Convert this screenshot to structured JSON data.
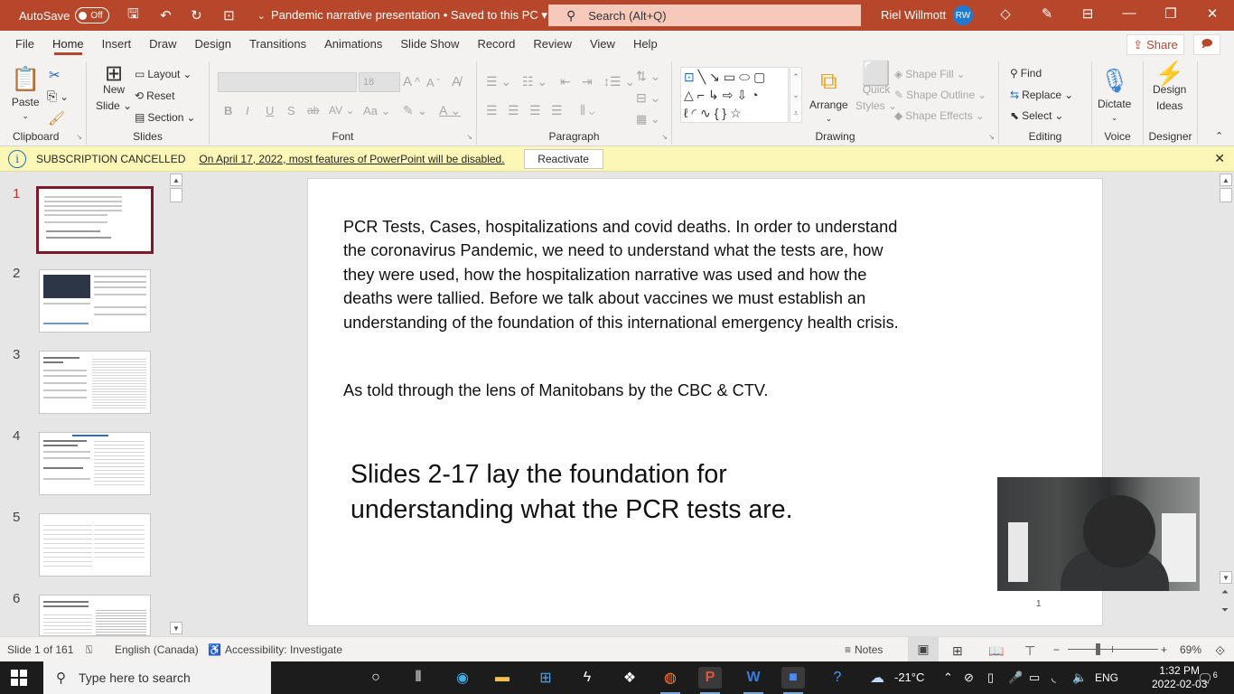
{
  "titlebar": {
    "autosave_label": "AutoSave",
    "autosave_state": "Off",
    "document_title": "Pandemic narrative presentation • Saved to this PC",
    "search_placeholder": "Search (Alt+Q)",
    "user_name": "Riel Willmott",
    "user_initials": "RW"
  },
  "menu": {
    "tabs": [
      "File",
      "Home",
      "Insert",
      "Draw",
      "Design",
      "Transitions",
      "Animations",
      "Slide Show",
      "Record",
      "Review",
      "View",
      "Help"
    ],
    "active_tab": "Home",
    "share_label": "Share"
  },
  "ribbon": {
    "clipboard": {
      "label": "Clipboard",
      "paste": "Paste"
    },
    "slides": {
      "label": "Slides",
      "new_slide_1": "New",
      "new_slide_2": "Slide",
      "layout": "Layout",
      "reset": "Reset",
      "section": "Section"
    },
    "font": {
      "label": "Font",
      "font_name": "",
      "font_size": "18"
    },
    "paragraph": {
      "label": "Paragraph"
    },
    "drawing": {
      "label": "Drawing",
      "arrange": "Arrange",
      "quick_styles_1": "Quick",
      "quick_styles_2": "Styles",
      "shape_fill": "Shape Fill",
      "shape_outline": "Shape Outline",
      "shape_effects": "Shape Effects"
    },
    "editing": {
      "label": "Editing",
      "find": "Find",
      "replace": "Replace",
      "select": "Select"
    },
    "voice": {
      "label": "Voice",
      "dictate": "Dictate"
    },
    "designer": {
      "label": "Designer",
      "design_ideas_1": "Design",
      "design_ideas_2": "Ideas"
    }
  },
  "notice": {
    "title": "SUBSCRIPTION CANCELLED",
    "message": "On April 17, 2022, most features of PowerPoint will be disabled.",
    "button": "Reactivate"
  },
  "thumbnails": [
    {
      "number": "1",
      "active": true
    },
    {
      "number": "2",
      "active": false
    },
    {
      "number": "3",
      "active": false
    },
    {
      "number": "4",
      "active": false
    },
    {
      "number": "5",
      "active": false
    },
    {
      "number": "6",
      "active": false
    }
  ],
  "slide": {
    "body": "PCR Tests, Cases, hospitalizations and covid deaths. In order to understand the coronavirus Pandemic, we need to understand what the tests are, how they were used, how the hospitalization narrative was used and how the deaths were tallied. Before we talk about vaccines we must establish an understanding of the foundation of this international emergency health crisis.",
    "subtitle": "As told through the lens of Manitobans by the CBC & CTV.",
    "callout_line1": "Slides 2-17 lay the foundation for",
    "callout_line2": "understanding what the PCR tests are.",
    "page_number": "1"
  },
  "statusbar": {
    "slide_counter": "Slide 1 of 161",
    "language": "English (Canada)",
    "accessibility": "Accessibility: Investigate",
    "notes": "Notes",
    "zoom_percent": "69%",
    "zoom_value": 69
  },
  "taskbar": {
    "search_placeholder": "Type here to search",
    "temperature": "-21°C",
    "language": "ENG",
    "time": "1:32 PM",
    "date": "2022-02-03",
    "notification_count": "6"
  }
}
